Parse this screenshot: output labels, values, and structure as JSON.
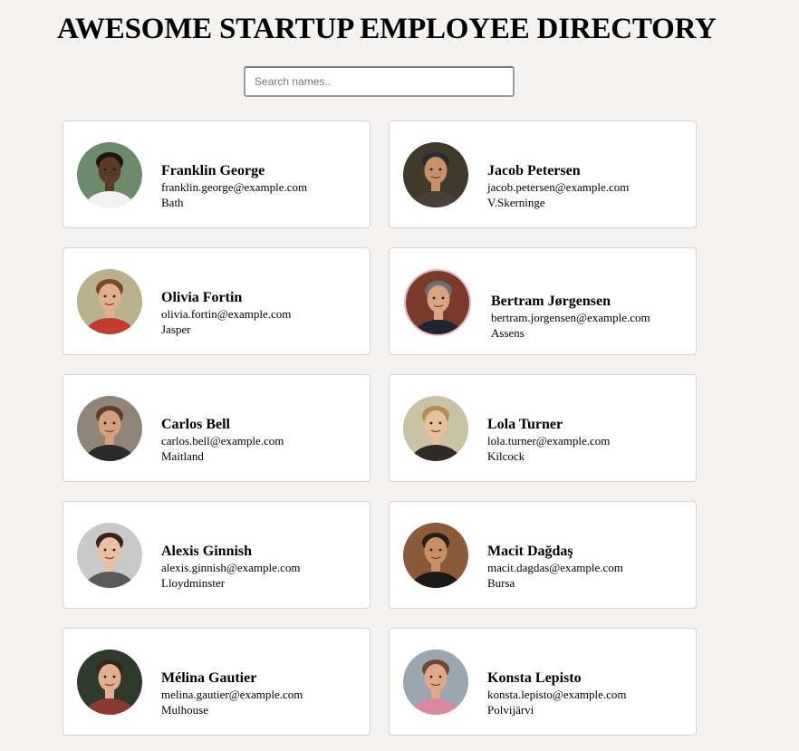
{
  "header": {
    "title": "AWESOME STARTUP EMPLOYEE DIRECTORY"
  },
  "search": {
    "placeholder": "Search names.."
  },
  "employees": [
    {
      "name": "Franklin George",
      "email": "franklin.george@example.com",
      "city": "Bath",
      "avatar_icon": "person-photo-icon",
      "bg": "#6d8a6a",
      "skin": "#5a3a28",
      "hair": "#1f1510",
      "shirt": "#f2f2f2"
    },
    {
      "name": "Jacob Petersen",
      "email": "jacob.petersen@example.com",
      "city": "V.Skerninge",
      "avatar_icon": "person-photo-icon",
      "bg": "#3f3a2c",
      "skin": "#c8906a",
      "hair": "#2b2b2b",
      "shirt": "#4a4038"
    },
    {
      "name": "Olivia Fortin",
      "email": "olivia.fortin@example.com",
      "city": "Jasper",
      "avatar_icon": "person-photo-icon",
      "bg": "#b9b08d",
      "skin": "#e0b08e",
      "hair": "#7a4a2a",
      "shirt": "#c23a30"
    },
    {
      "name": "Bertram Jørgensen",
      "email": "bertram.jorgensen@example.com",
      "city": "Assens",
      "avatar_icon": "person-photo-icon",
      "bg": "#7a3a2c",
      "skin": "#d9a583",
      "hair": "#6e6e6e",
      "shirt": "#1e2430"
    },
    {
      "name": "Carlos Bell",
      "email": "carlos.bell@example.com",
      "city": "Maitland",
      "avatar_icon": "person-photo-icon",
      "bg": "#8e8578",
      "skin": "#d2a07e",
      "hair": "#5a3e2a",
      "shirt": "#2a2a2a"
    },
    {
      "name": "Lola Turner",
      "email": "lola.turner@example.com",
      "city": "Kilcock",
      "avatar_icon": "person-photo-icon",
      "bg": "#c9c2a4",
      "skin": "#e6bf9d",
      "hair": "#b48a55",
      "shirt": "#2e2a26"
    },
    {
      "name": "Alexis Ginnish",
      "email": "alexis.ginnish@example.com",
      "city": "Lloydminster",
      "avatar_icon": "person-photo-icon",
      "bg": "#c9c9c9",
      "skin": "#e9c0a4",
      "hair": "#3a2418",
      "shirt": "#5a5a5a"
    },
    {
      "name": "Macit Dağdaş",
      "email": "macit.dagdas@example.com",
      "city": "Bursa",
      "avatar_icon": "person-photo-icon",
      "bg": "#8a5a3a",
      "skin": "#c98e66",
      "hair": "#2a1e16",
      "shirt": "#1c1a18"
    },
    {
      "name": "Mélina Gautier",
      "email": "melina.gautier@example.com",
      "city": "Mulhouse",
      "avatar_icon": "person-photo-icon",
      "bg": "#2e3a2c",
      "skin": "#e2b090",
      "hair": "#3a2418",
      "shirt": "#8a3a2e"
    },
    {
      "name": "Konsta Lepisto",
      "email": "konsta.lepisto@example.com",
      "city": "Polvijärvi",
      "avatar_icon": "person-photo-icon",
      "bg": "#9aa6b0",
      "skin": "#e0a888",
      "hair": "#6a4a34",
      "shirt": "#d88aa0"
    }
  ]
}
